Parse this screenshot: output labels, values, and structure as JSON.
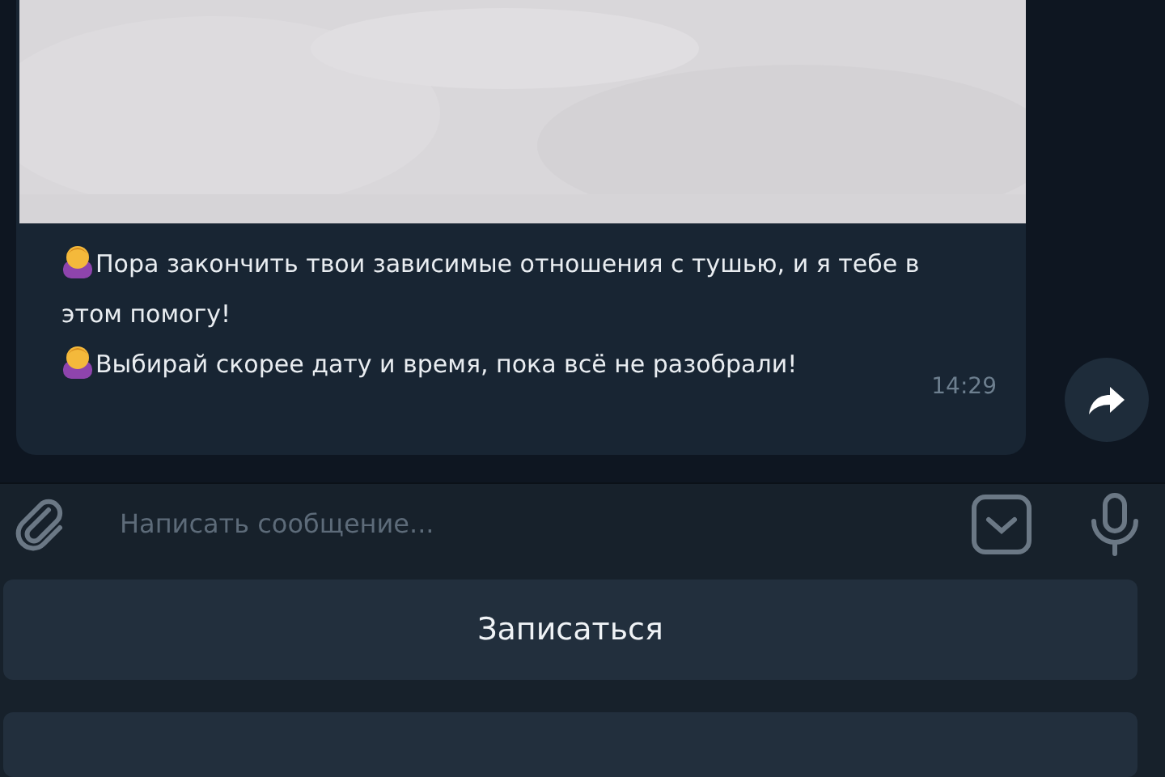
{
  "message": {
    "paragraphs": [
      "Пора закончить твои зависимые отношения с тушью, и я тебе в этом помогу!",
      "Выбирай скорее дату и время, пока всё не разобрали!"
    ],
    "time": "14:29"
  },
  "composer": {
    "placeholder": "Написать сообщение..."
  },
  "keyboard_buttons": [
    {
      "label": "Записаться"
    }
  ]
}
